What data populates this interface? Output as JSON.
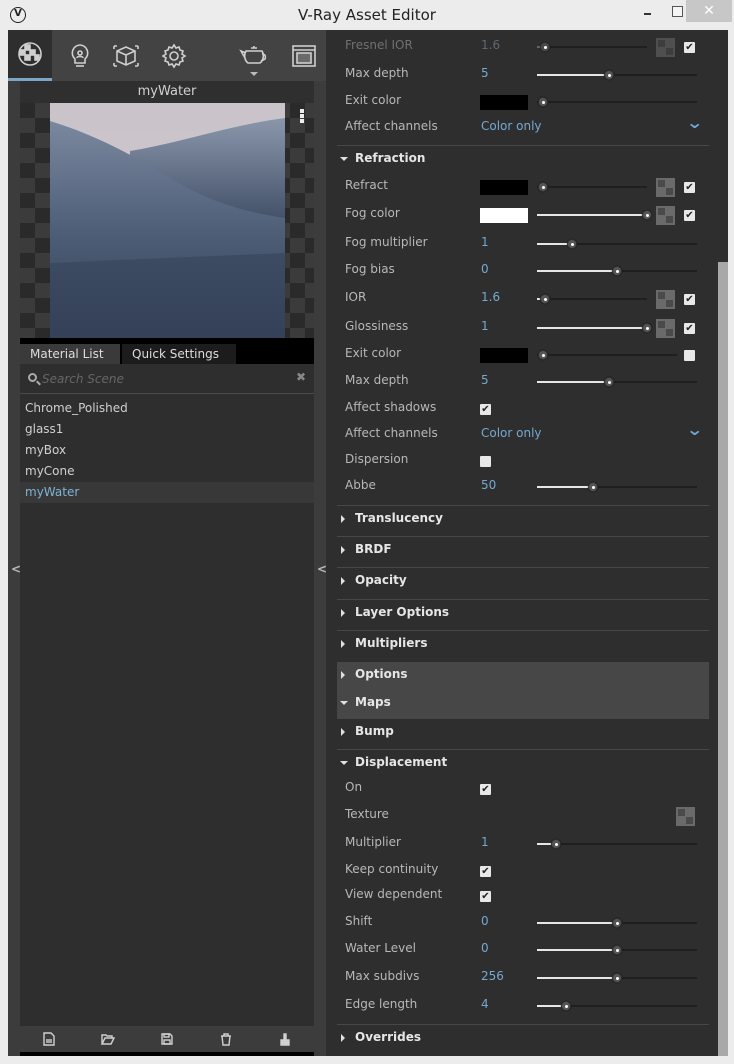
{
  "window": {
    "title": "V-Ray Asset Editor",
    "controls": {
      "minimize": "minimize",
      "maximize": "maximize",
      "close": "✕"
    }
  },
  "toolbar": {
    "items": [
      {
        "name": "materials",
        "icon": "material-sphere-icon",
        "active": true
      },
      {
        "name": "lights",
        "icon": "lightbulb-icon",
        "active": false
      },
      {
        "name": "geometry",
        "icon": "cube-icon",
        "active": false
      },
      {
        "name": "settings",
        "icon": "gear-icon",
        "active": false
      },
      {
        "name": "render",
        "icon": "teapot-icon",
        "active": false
      },
      {
        "name": "frame-buffer",
        "icon": "frame-buffer-icon",
        "active": false
      }
    ]
  },
  "preview": {
    "title": "myWater"
  },
  "tabs": [
    {
      "label": "Material List",
      "active": true
    },
    {
      "label": "Quick Settings",
      "active": false
    }
  ],
  "search": {
    "placeholder": "Search Scene",
    "value": ""
  },
  "materials": [
    {
      "name": "Chrome_Polished",
      "selected": false
    },
    {
      "name": "glass1",
      "selected": false
    },
    {
      "name": "myBox",
      "selected": false
    },
    {
      "name": "myCone",
      "selected": false
    },
    {
      "name": "myWater",
      "selected": true
    }
  ],
  "bottom_actions": [
    "new-file-icon",
    "open-folder-icon",
    "save-icon",
    "trash-icon",
    "purge-brush-icon"
  ],
  "properties": {
    "reflection_tail": [
      {
        "label": "Fresnel IOR",
        "value": "1.6",
        "slider": 0.07,
        "texture": true,
        "checked": true,
        "disabled": true
      },
      {
        "label": "Max depth",
        "value": "5",
        "slider": 0.45
      },
      {
        "label": "Exit color",
        "color": "#000000",
        "slider": 0.0
      },
      {
        "label": "Affect channels",
        "dropdown": "Color only"
      }
    ],
    "refraction": {
      "title": "Refraction",
      "expanded": true,
      "rows": [
        {
          "label": "Refract",
          "color": "#000000",
          "slider": 0.0,
          "texture": true,
          "checked": true
        },
        {
          "label": "Fog color",
          "color": "#ffffff",
          "slider": 1.0,
          "texture": true,
          "checked": true
        },
        {
          "label": "Fog multiplier",
          "value": "1",
          "slider": 0.22
        },
        {
          "label": "Fog bias",
          "value": "0",
          "slider": 0.5
        },
        {
          "label": "IOR",
          "value": "1.6",
          "slider": 0.07,
          "texture": true,
          "checked": true
        },
        {
          "label": "Glossiness",
          "value": "1",
          "slider": 1.0,
          "texture": true,
          "checked": true
        },
        {
          "label": "Exit color",
          "color": "#000000",
          "slider": 0.0,
          "checked": false
        },
        {
          "label": "Max depth",
          "value": "5",
          "slider": 0.45
        },
        {
          "label": "Affect shadows",
          "checkbox": true
        },
        {
          "label": "Affect channels",
          "dropdown": "Color only"
        },
        {
          "label": "Dispersion",
          "checkbox": false
        },
        {
          "label": "Abbe",
          "value": "50",
          "slider": 0.35
        }
      ]
    },
    "collapsed_sections": [
      "Translucency",
      "BRDF",
      "Opacity",
      "Layer Options",
      "Multipliers"
    ],
    "options_section": {
      "title": "Options",
      "expanded": false
    },
    "maps_section": {
      "title": "Maps",
      "expanded": true
    },
    "bump_section": {
      "title": "Bump",
      "expanded": false
    },
    "displacement": {
      "title": "Displacement",
      "expanded": true,
      "rows": [
        {
          "label": "On",
          "checkbox": true
        },
        {
          "label": "Texture",
          "texture": true
        },
        {
          "label": "Multiplier",
          "value": "1",
          "slider": 0.12
        },
        {
          "label": "Keep continuity",
          "checkbox": true
        },
        {
          "label": "View dependent",
          "checkbox": true
        },
        {
          "label": "Shift",
          "value": "0",
          "slider": 0.5
        },
        {
          "label": "Water Level",
          "value": "0",
          "slider": 0.5
        },
        {
          "label": "Max subdivs",
          "value": "256",
          "slider": 0.5
        },
        {
          "label": "Edge length",
          "value": "4",
          "slider": 0.18
        }
      ]
    },
    "overrides_section": {
      "title": "Overrides",
      "expanded": false
    }
  }
}
